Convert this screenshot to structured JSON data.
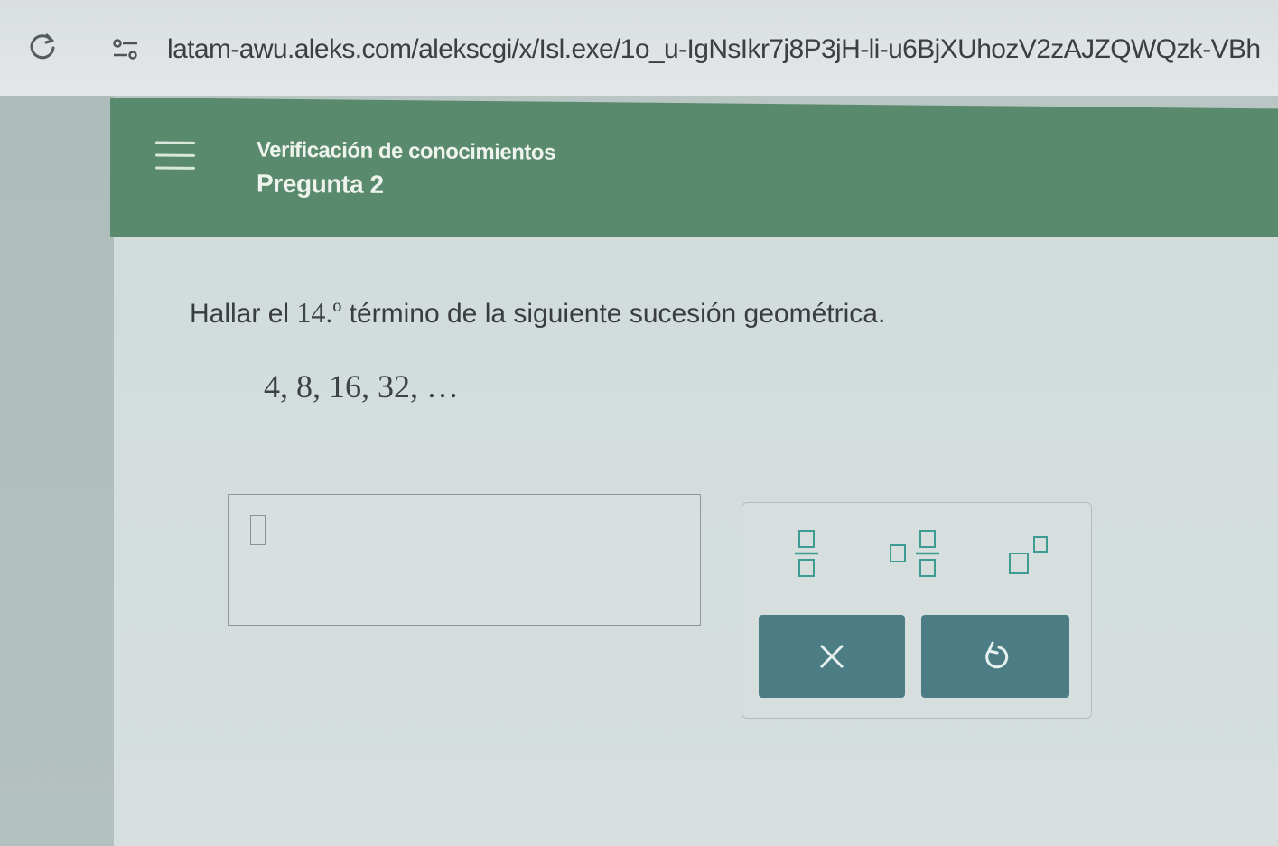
{
  "browser": {
    "url": "latam-awu.aleks.com/alekscgi/x/Isl.exe/1o_u-IgNsIkr7j8P3jH-li-u6BjXUhozV2zAJZQWQzk-VBh"
  },
  "header": {
    "title": "Verificación de conocimientos",
    "subtitle": "Pregunta 2"
  },
  "question": {
    "prefix": "Hallar el ",
    "ordinal": "14.º",
    "suffix": " término de la siguiente sucesión geométrica.",
    "sequence": "4, 8, 16, 32, …"
  },
  "answer": {
    "value": ""
  },
  "toolbox": {
    "tools": [
      "fraction",
      "mixed-number",
      "exponent"
    ],
    "clear_symbol": "×",
    "undo_symbol": "↺"
  },
  "colors": {
    "header_green": "#5a8a6d",
    "button_teal": "#4c7d85",
    "tool_icon": "#3f9c93"
  }
}
